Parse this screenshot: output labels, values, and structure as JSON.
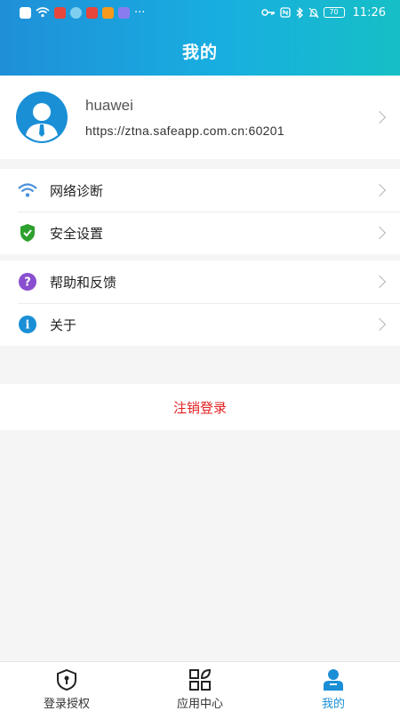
{
  "status_bar": {
    "time": "11:26",
    "battery": "70",
    "more": "···"
  },
  "header": {
    "title": "我的"
  },
  "profile": {
    "username": "huawei",
    "server": "https://ztna.safeapp.com.cn:60201"
  },
  "menu_group_1": [
    {
      "label": "网络诊断",
      "icon": "wifi-icon"
    },
    {
      "label": "安全设置",
      "icon": "shield-check-icon"
    }
  ],
  "menu_group_2": [
    {
      "label": "帮助和反馈",
      "icon": "help-icon",
      "glyph": "?"
    },
    {
      "label": "关于",
      "icon": "info-icon",
      "glyph": "i"
    }
  ],
  "logout": {
    "label": "注销登录"
  },
  "tabs": [
    {
      "label": "登录授权",
      "icon": "shield-key-icon"
    },
    {
      "label": "应用中心",
      "icon": "apps-grid-icon"
    },
    {
      "label": "我的",
      "icon": "user-icon",
      "active": true
    }
  ],
  "colors": {
    "header_start": "#1f8fd8",
    "header_end": "#16bfc6",
    "accent": "#1a8fd6",
    "logout": "#e02020"
  }
}
